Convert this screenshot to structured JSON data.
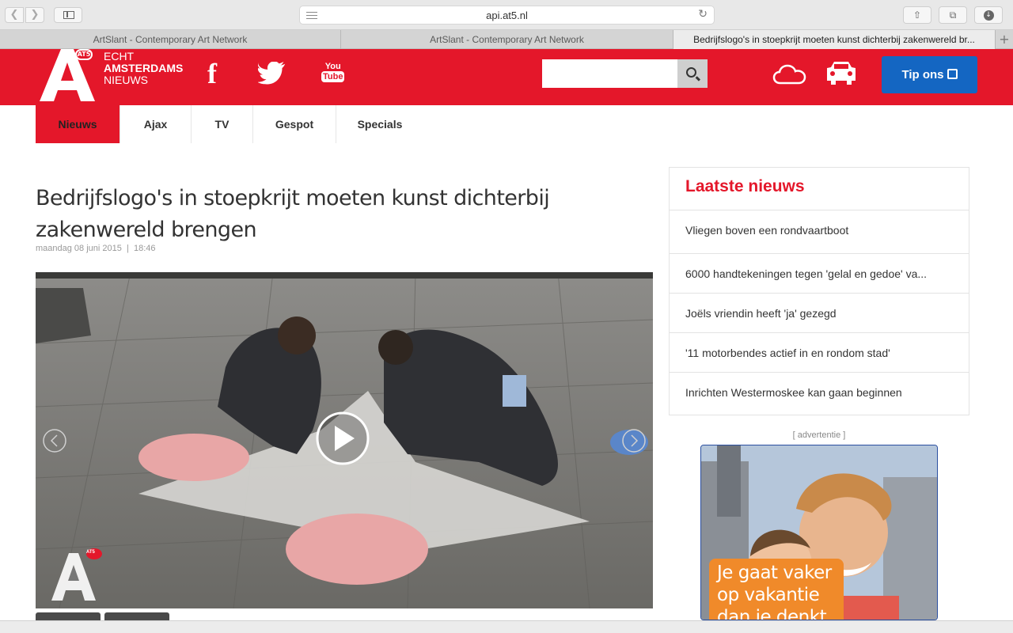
{
  "browser": {
    "url": "api.at5.nl",
    "tabs": [
      {
        "title": "ArtSlant - Contemporary Art Network",
        "active": false
      },
      {
        "title": "ArtSlant - Contemporary Art Network",
        "active": false
      },
      {
        "title": "Bedrijfslogo's in stoepkrijt moeten kunst dichterbij zakenwereld br...",
        "active": true
      }
    ],
    "new_tab_glyph": "+"
  },
  "header": {
    "logo_badge": "AT5",
    "tagline": [
      "ECHT",
      "AMSTERDAMS",
      "NIEUWS"
    ],
    "social": {
      "facebook": "f",
      "youtube_top": "You",
      "youtube_bottom": "Tube"
    },
    "search_placeholder": "",
    "tip_label": "Tip ons",
    "brand_color": "#e4172a",
    "tip_color": "#1466c2"
  },
  "nav": {
    "items": [
      {
        "label": "Nieuws",
        "active": true
      },
      {
        "label": "Ajax",
        "active": false
      },
      {
        "label": "TV",
        "active": false
      },
      {
        "label": "Gespot",
        "active": false
      },
      {
        "label": "Specials",
        "active": false
      }
    ]
  },
  "article": {
    "title": "Bedrijfslogo's in stoepkrijt moeten kunst dichterbij zakenwereld brengen",
    "date": "maandag 08 juni 2015",
    "time": "18:46",
    "video_badge": "AT5"
  },
  "sidebar": {
    "title": "Laatste nieuws",
    "items": [
      "Vliegen boven een rondvaartboot",
      "6000 handtekeningen tegen 'gelal en gedoe' va...",
      "Joëls vriendin heeft 'ja' gezegd",
      "'11 motorbendes actief in en rondom stad'",
      "Inrichten Westermoskee kan gaan beginnen"
    ],
    "ad_label": "[ advertentie ]",
    "ad_text": "Je gaat vaker op vakantie dan je denkt"
  }
}
